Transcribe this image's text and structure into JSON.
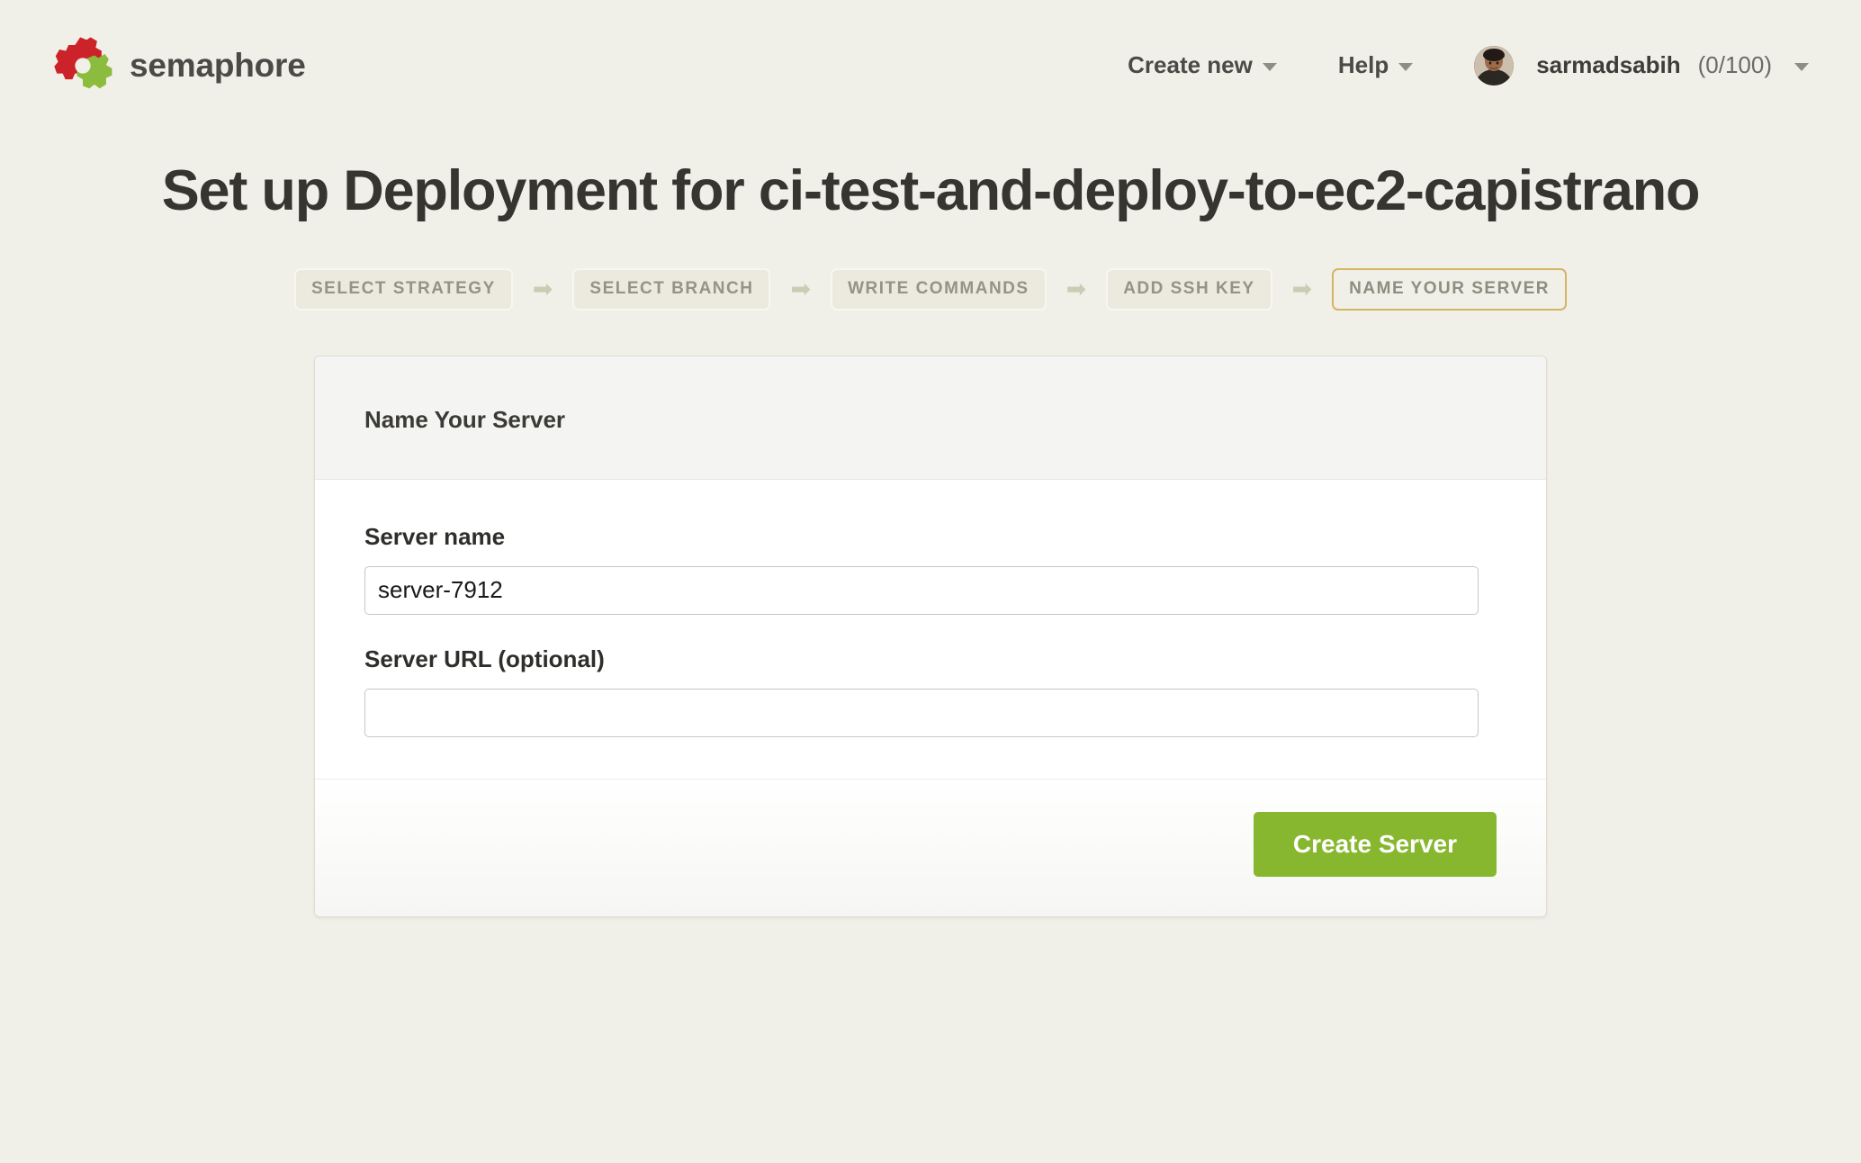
{
  "header": {
    "brand_name": "semaphore",
    "brand_colors": {
      "gear_red": "#cc2229",
      "gear_green": "#8cbc3e",
      "wordmark": "#4a4a47"
    },
    "nav": [
      {
        "label": "Create new",
        "has_caret": true
      },
      {
        "label": "Help",
        "has_caret": true
      }
    ],
    "user": {
      "name": "sarmadsabih",
      "count": "(0/100)",
      "has_caret": true,
      "avatar_alt": "user-avatar"
    }
  },
  "page": {
    "title": "Set up Deployment for ci-test-and-deploy-to-ec2-capistrano"
  },
  "steps": {
    "arrow_glyph": "➡",
    "active_border_color": "#d3b664",
    "items": [
      {
        "label": "SELECT STRATEGY",
        "active": false
      },
      {
        "label": "SELECT BRANCH",
        "active": false
      },
      {
        "label": "WRITE COMMANDS",
        "active": false
      },
      {
        "label": "ADD SSH KEY",
        "active": false
      },
      {
        "label": "NAME YOUR SERVER",
        "active": true
      }
    ]
  },
  "card": {
    "heading": "Name Your Server",
    "fields": [
      {
        "label": "Server name",
        "value": "server-7912",
        "placeholder": ""
      },
      {
        "label": "Server URL (optional)",
        "value": "",
        "placeholder": ""
      }
    ],
    "footer": {
      "submit_label": "Create Server",
      "submit_color": "#87b72f"
    }
  }
}
